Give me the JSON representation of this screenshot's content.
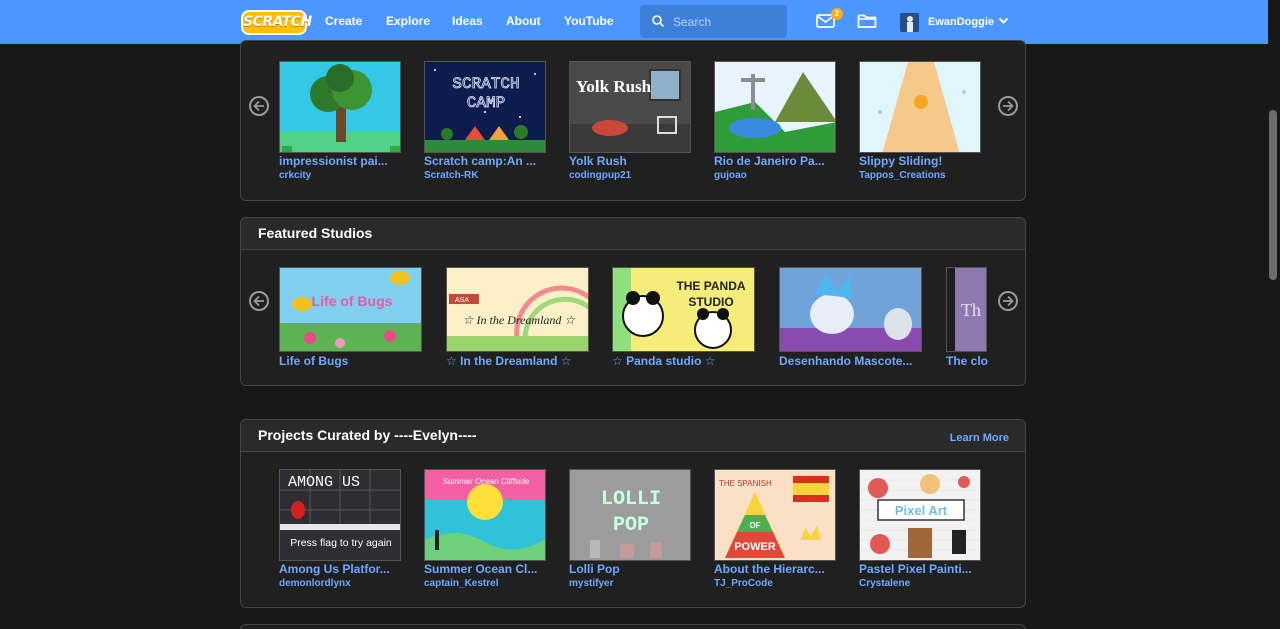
{
  "nav": {
    "logo": "SCRATCH",
    "links": [
      "Create",
      "Explore",
      "Ideas",
      "About",
      "YouTube"
    ],
    "search_placeholder": "Search",
    "message_count": "2",
    "username": "EwanDoggie"
  },
  "top_row": {
    "items": [
      {
        "title": "impressionist pai...",
        "author": "crkcity"
      },
      {
        "title": "Scratch camp:An ...",
        "author": "Scratch-RK"
      },
      {
        "title": "Yolk Rush",
        "author": "codingpup21"
      },
      {
        "title": "Rio de Janeiro Pa...",
        "author": "gujoao"
      },
      {
        "title": "Slippy Sliding!",
        "author": "Tappos_Creations"
      }
    ]
  },
  "featured_studios": {
    "title": "Featured Studios",
    "items": [
      {
        "title": "Life of Bugs"
      },
      {
        "title": "☆ In the Dreamland ☆"
      },
      {
        "title": "☆ Panda studio ☆"
      },
      {
        "title": "Desenhando Mascote..."
      },
      {
        "title": "The clo"
      }
    ]
  },
  "curated": {
    "title": "Projects Curated by ----Evelyn----",
    "learn_more": "Learn More",
    "items": [
      {
        "title": "Among Us Platfor...",
        "author": "demonlordlynx"
      },
      {
        "title": "Summer Ocean Cl...",
        "author": "captain_Kestrel"
      },
      {
        "title": "Lolli Pop",
        "author": "mystifyer"
      },
      {
        "title": "About the Hierarc...",
        "author": "TJ_ProCode"
      },
      {
        "title": "Pastel Pixel Painti...",
        "author": "Crystalene"
      }
    ]
  },
  "thumb_text": {
    "scratch_camp": "SCRATCH CAMP",
    "yolk_rush": "Yolk Rush",
    "life_of_bugs": "Life of Bugs",
    "dreamland": "☆ In the Dreamland ☆",
    "asariver": "ASA",
    "panda": "THE PANDA STUDIO",
    "among_us": "AMONG US",
    "press_flag": "Press flag to try again",
    "summer_ocean": "Summer Ocean Cliffside",
    "lolli": "LOLLI",
    "pop": "POP",
    "the_spanish": "THE SPANISH",
    "of": "OF",
    "power": "POWER",
    "pixel_art": "Pixel Art",
    "the_clo_thumb": "Th"
  },
  "colors": {
    "nav_blue": "#4c97ff",
    "link_blue": "#6ea8ff",
    "panel": "#202020",
    "background": "#181818"
  },
  "icons": [
    "scratch-logo",
    "search-icon",
    "messages-icon",
    "my-stuff-folder-icon",
    "chevron-down-icon",
    "arrow-left-icon",
    "arrow-right-icon"
  ]
}
